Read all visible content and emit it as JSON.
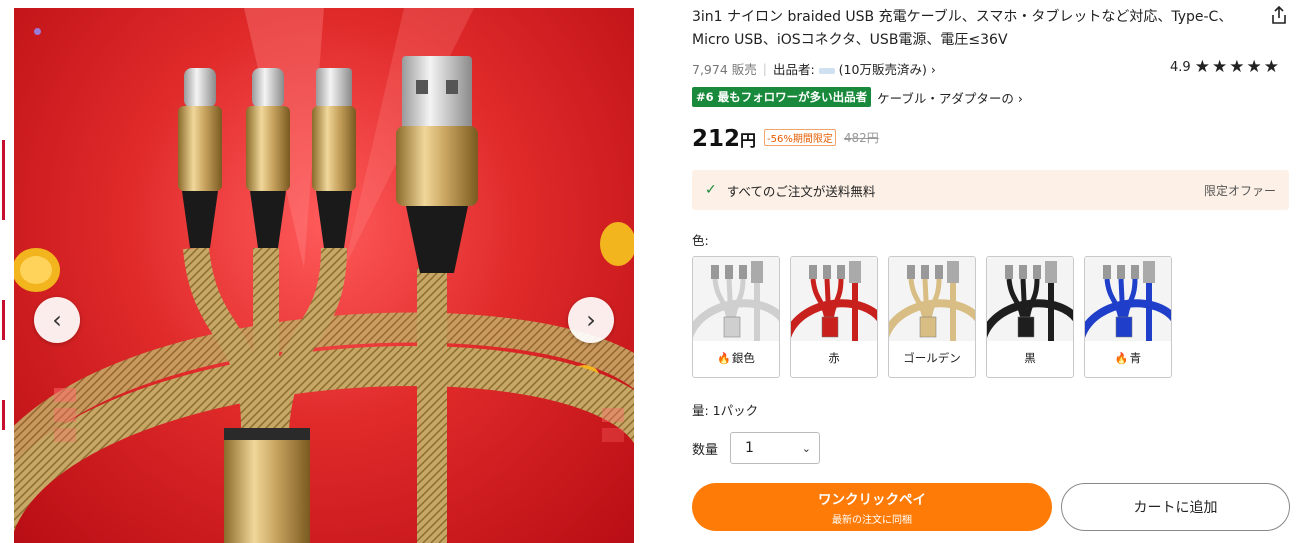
{
  "product": {
    "title": "3in1 ナイロン braided USB 充電ケーブル、スマホ・タブレットなど対応、Type-C、Micro USB、iOSコネクタ、USB電源、電圧≤36V",
    "sold": "7,974 販売",
    "seller_label": "出品者:",
    "seller_sales": "(10万販売済み)",
    "seller_chevron": "›",
    "rating": "4.9",
    "stars": 5,
    "rank_badge": "#6 最もフォロワーが多い出品者",
    "rank_category": "ケーブル・アダプターの ›"
  },
  "price": {
    "current": "212",
    "currency": "円",
    "discount_badge": "-56%期間限定",
    "original": "482円"
  },
  "shipping": {
    "text": "すべてのご注文が送料無料",
    "offer": "限定オファー"
  },
  "color": {
    "label": "色:",
    "options": [
      {
        "name": "銀色",
        "hot": true,
        "cable": "#cfcfcf"
      },
      {
        "name": "赤",
        "hot": false,
        "cable": "#c8201c"
      },
      {
        "name": "ゴールデン",
        "hot": false,
        "cable": "#d8bd84"
      },
      {
        "name": "黒",
        "hot": false,
        "cable": "#1e1e1e"
      },
      {
        "name": "青",
        "hot": true,
        "cable": "#1f3ec9"
      }
    ]
  },
  "quantity": {
    "type_label": "量: 1パック",
    "label": "数量",
    "value": "1"
  },
  "buttons": {
    "buy_main": "ワンクリックペイ",
    "buy_sub": "最新の注文に同梱",
    "cart": "カートに追加"
  },
  "gallery": {
    "prev": "‹",
    "next": "›"
  },
  "colors": {
    "accent_orange": "#fd7b06",
    "rank_green": "#198a3b",
    "ship_bg": "#fdf1e7"
  }
}
